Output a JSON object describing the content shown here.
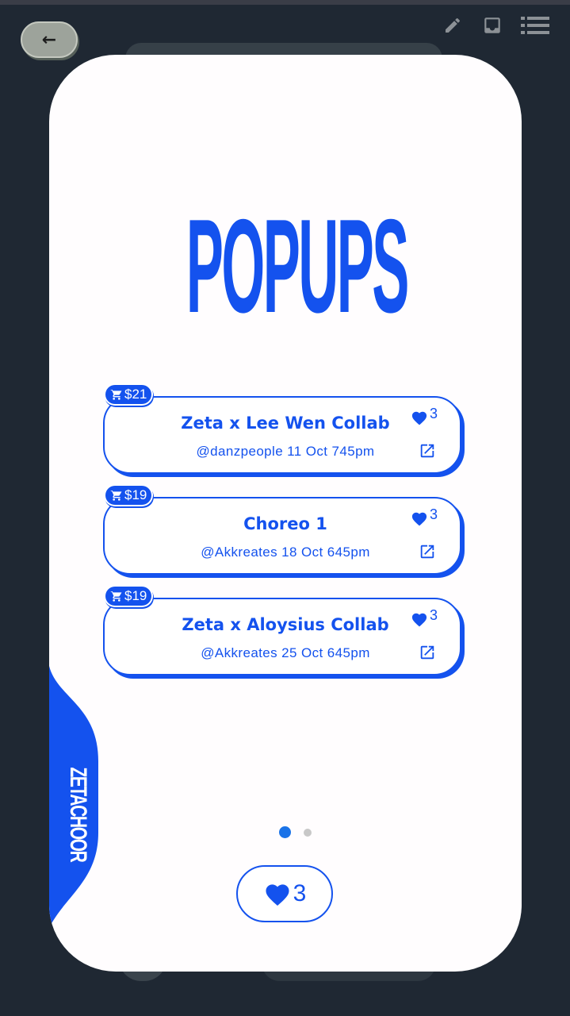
{
  "colors": {
    "accent": "#1452ee",
    "background": "#1f2833",
    "card": "#fffdfe"
  },
  "header": {
    "back_label": "←"
  },
  "toolbar_icons": [
    "pencil-icon",
    "inbox-icon",
    "list-icon"
  ],
  "title": "POPUPS",
  "side_brand": "ZETACHOOR",
  "items": [
    {
      "price": "$21",
      "title": "Zeta x Lee Wen Collab",
      "subtitle": "@danzpeople 11 Oct 745pm",
      "likes": "3"
    },
    {
      "price": "$19",
      "title": "Choreo 1",
      "subtitle": "@Akkreates 18 Oct 645pm",
      "likes": "3"
    },
    {
      "price": "$19",
      "title": "Zeta x Aloysius Collab",
      "subtitle": "@Akkreates 25 Oct 645pm",
      "likes": "3"
    }
  ],
  "pagination": {
    "current": 1,
    "total": 2
  },
  "footer": {
    "likes": "3"
  }
}
